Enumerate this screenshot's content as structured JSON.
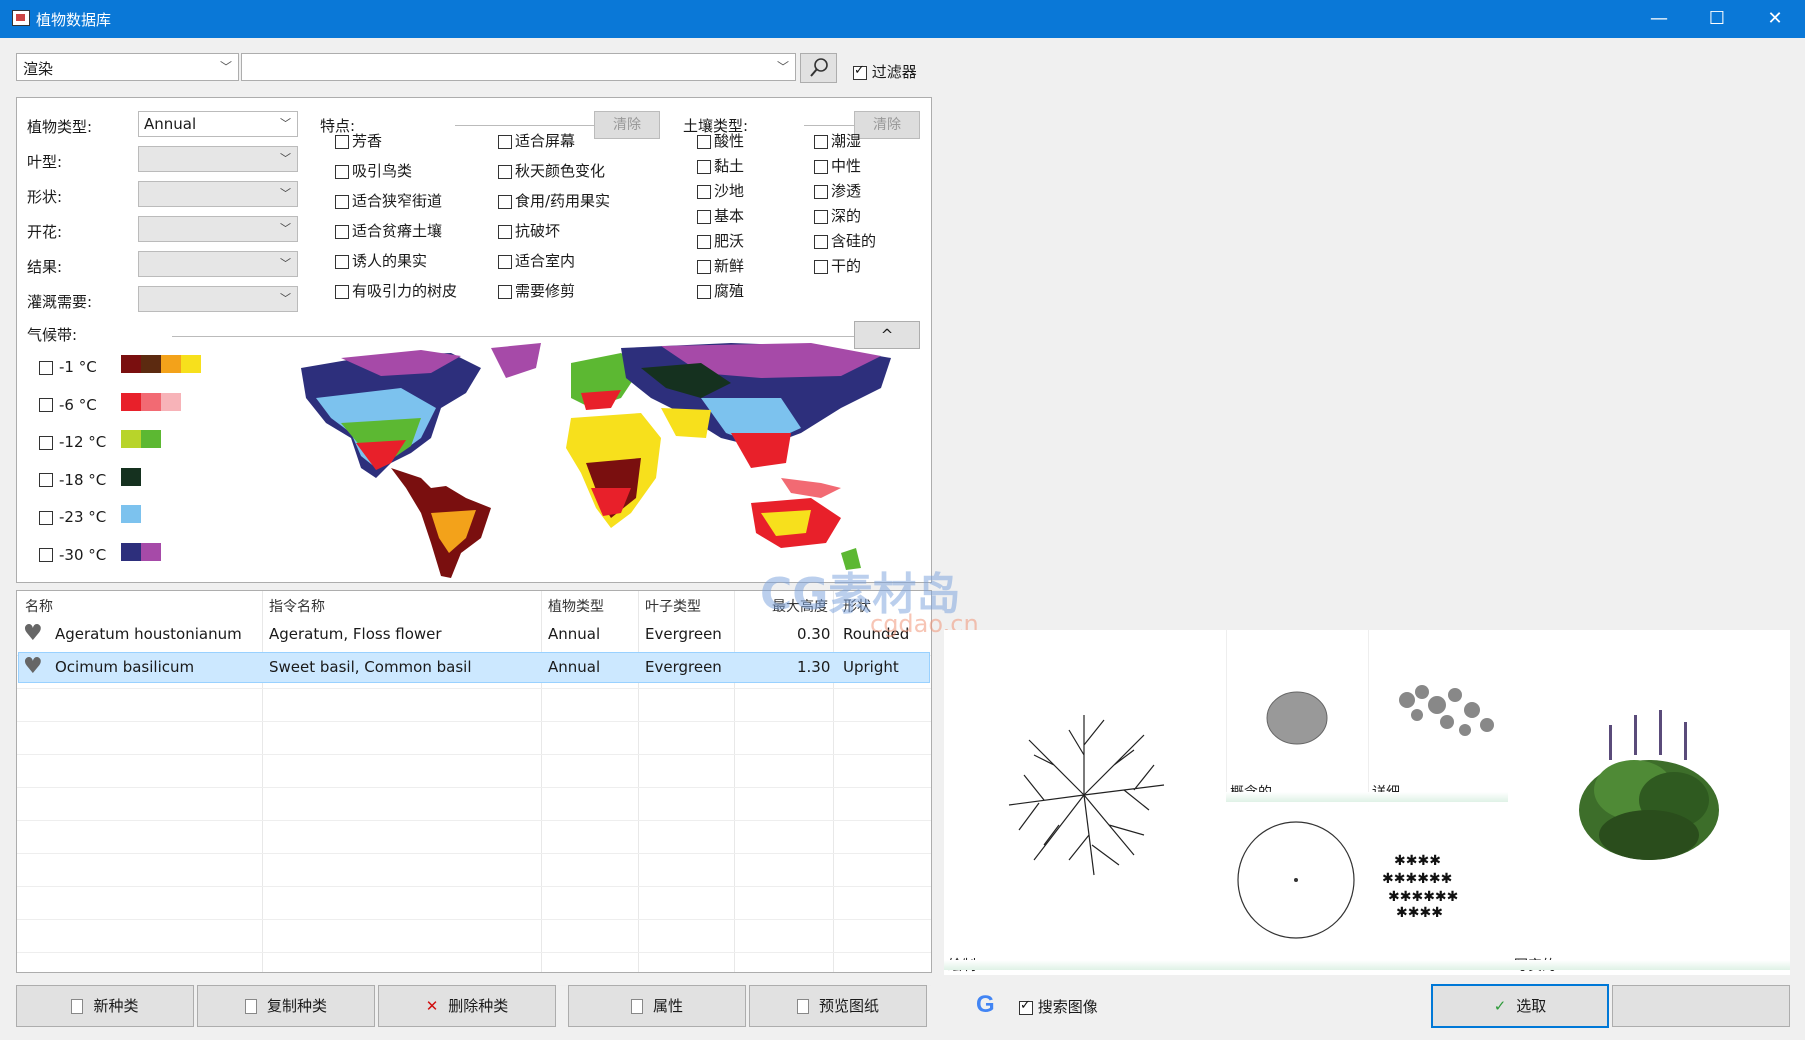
{
  "window": {
    "title": "植物数据库",
    "minimize_icon": "minimize-icon",
    "maximize_icon": "maximize-icon",
    "close_icon": "close-icon",
    "min_glyph": "—",
    "max_glyph": "☐",
    "close_glyph": "✕"
  },
  "search": {
    "mode_value": "渲染",
    "query_value": "",
    "filter_label": "过滤器",
    "filter_checked": true
  },
  "filters": {
    "plant_type_label": "植物类型:",
    "plant_type_value": "Annual",
    "leaf_type_label": "叶型:",
    "shape_label": "形状:",
    "flowering_label": "开花:",
    "fruit_label": "结果:",
    "irrigation_label": "灌溉需要:",
    "features_label": "特点:",
    "features_clear": "清除",
    "features": [
      "芳香",
      "吸引鸟类",
      "适合狭窄街道",
      "适合贫瘠土壤",
      "诱人的果实",
      "有吸引力的树皮",
      "适合屏幕",
      "秋天颜色变化",
      "食用/药用果实",
      "抗破坏",
      "适合室内",
      "需要修剪"
    ],
    "soil_label": "土壤类型:",
    "soil_clear": "清除",
    "soils": [
      "酸性",
      "黏土",
      "沙地",
      "基本",
      "肥沃",
      "新鲜",
      "腐殖",
      "潮湿",
      "中性",
      "渗透",
      "深的",
      "含硅的",
      "干的"
    ],
    "climate_label": "气候带:",
    "collapse_glyph": "^",
    "climate_zones": [
      {
        "label": "-1 °C",
        "colors": [
          "#7a0f0f",
          "#5c2a10",
          "#f3a21a",
          "#f7e01c"
        ]
      },
      {
        "label": "-6 °C",
        "colors": [
          "#e8202a",
          "#f26a73",
          "#f7b3b8"
        ]
      },
      {
        "label": "-12 °C",
        "colors": [
          "#b8d42a",
          "#5cb832"
        ]
      },
      {
        "label": "-18 °C",
        "colors": [
          "#15311f"
        ]
      },
      {
        "label": "-23 °C",
        "colors": [
          "#7cc2ee"
        ]
      },
      {
        "label": "-30 °C",
        "colors": [
          "#2d2f7c",
          "#a64aa8"
        ]
      }
    ]
  },
  "table": {
    "headers": [
      "名称",
      "指令名称",
      "植物类型",
      "叶子类型",
      "最大高度",
      "形状"
    ],
    "rows": [
      {
        "name": "Ageratum houstonianum",
        "common": "Ageratum, Floss flower",
        "type": "Annual",
        "leaf": "Evergreen",
        "height": "0.30",
        "shape": "Rounded",
        "selected": false
      },
      {
        "name": "Ocimum basilicum",
        "common": "Sweet basil, Common basil",
        "type": "Annual",
        "leaf": "Evergreen",
        "height": "1.30",
        "shape": "Upright",
        "selected": true
      }
    ]
  },
  "watermark": {
    "main": "CG素材岛",
    "sub": "cgdao.cn"
  },
  "preview": {
    "plan_caption": "绘制",
    "conceptual_caption": "概念的",
    "detailed_caption": "详细",
    "realistic_caption": "写实的"
  },
  "bottom": {
    "new_species": "新种类",
    "copy_species": "复制种类",
    "delete_species": "删除种类",
    "properties": "属性",
    "preview_drawing": "预览图纸",
    "search_images": "搜索图像",
    "search_images_checked": true,
    "select": "选取"
  }
}
